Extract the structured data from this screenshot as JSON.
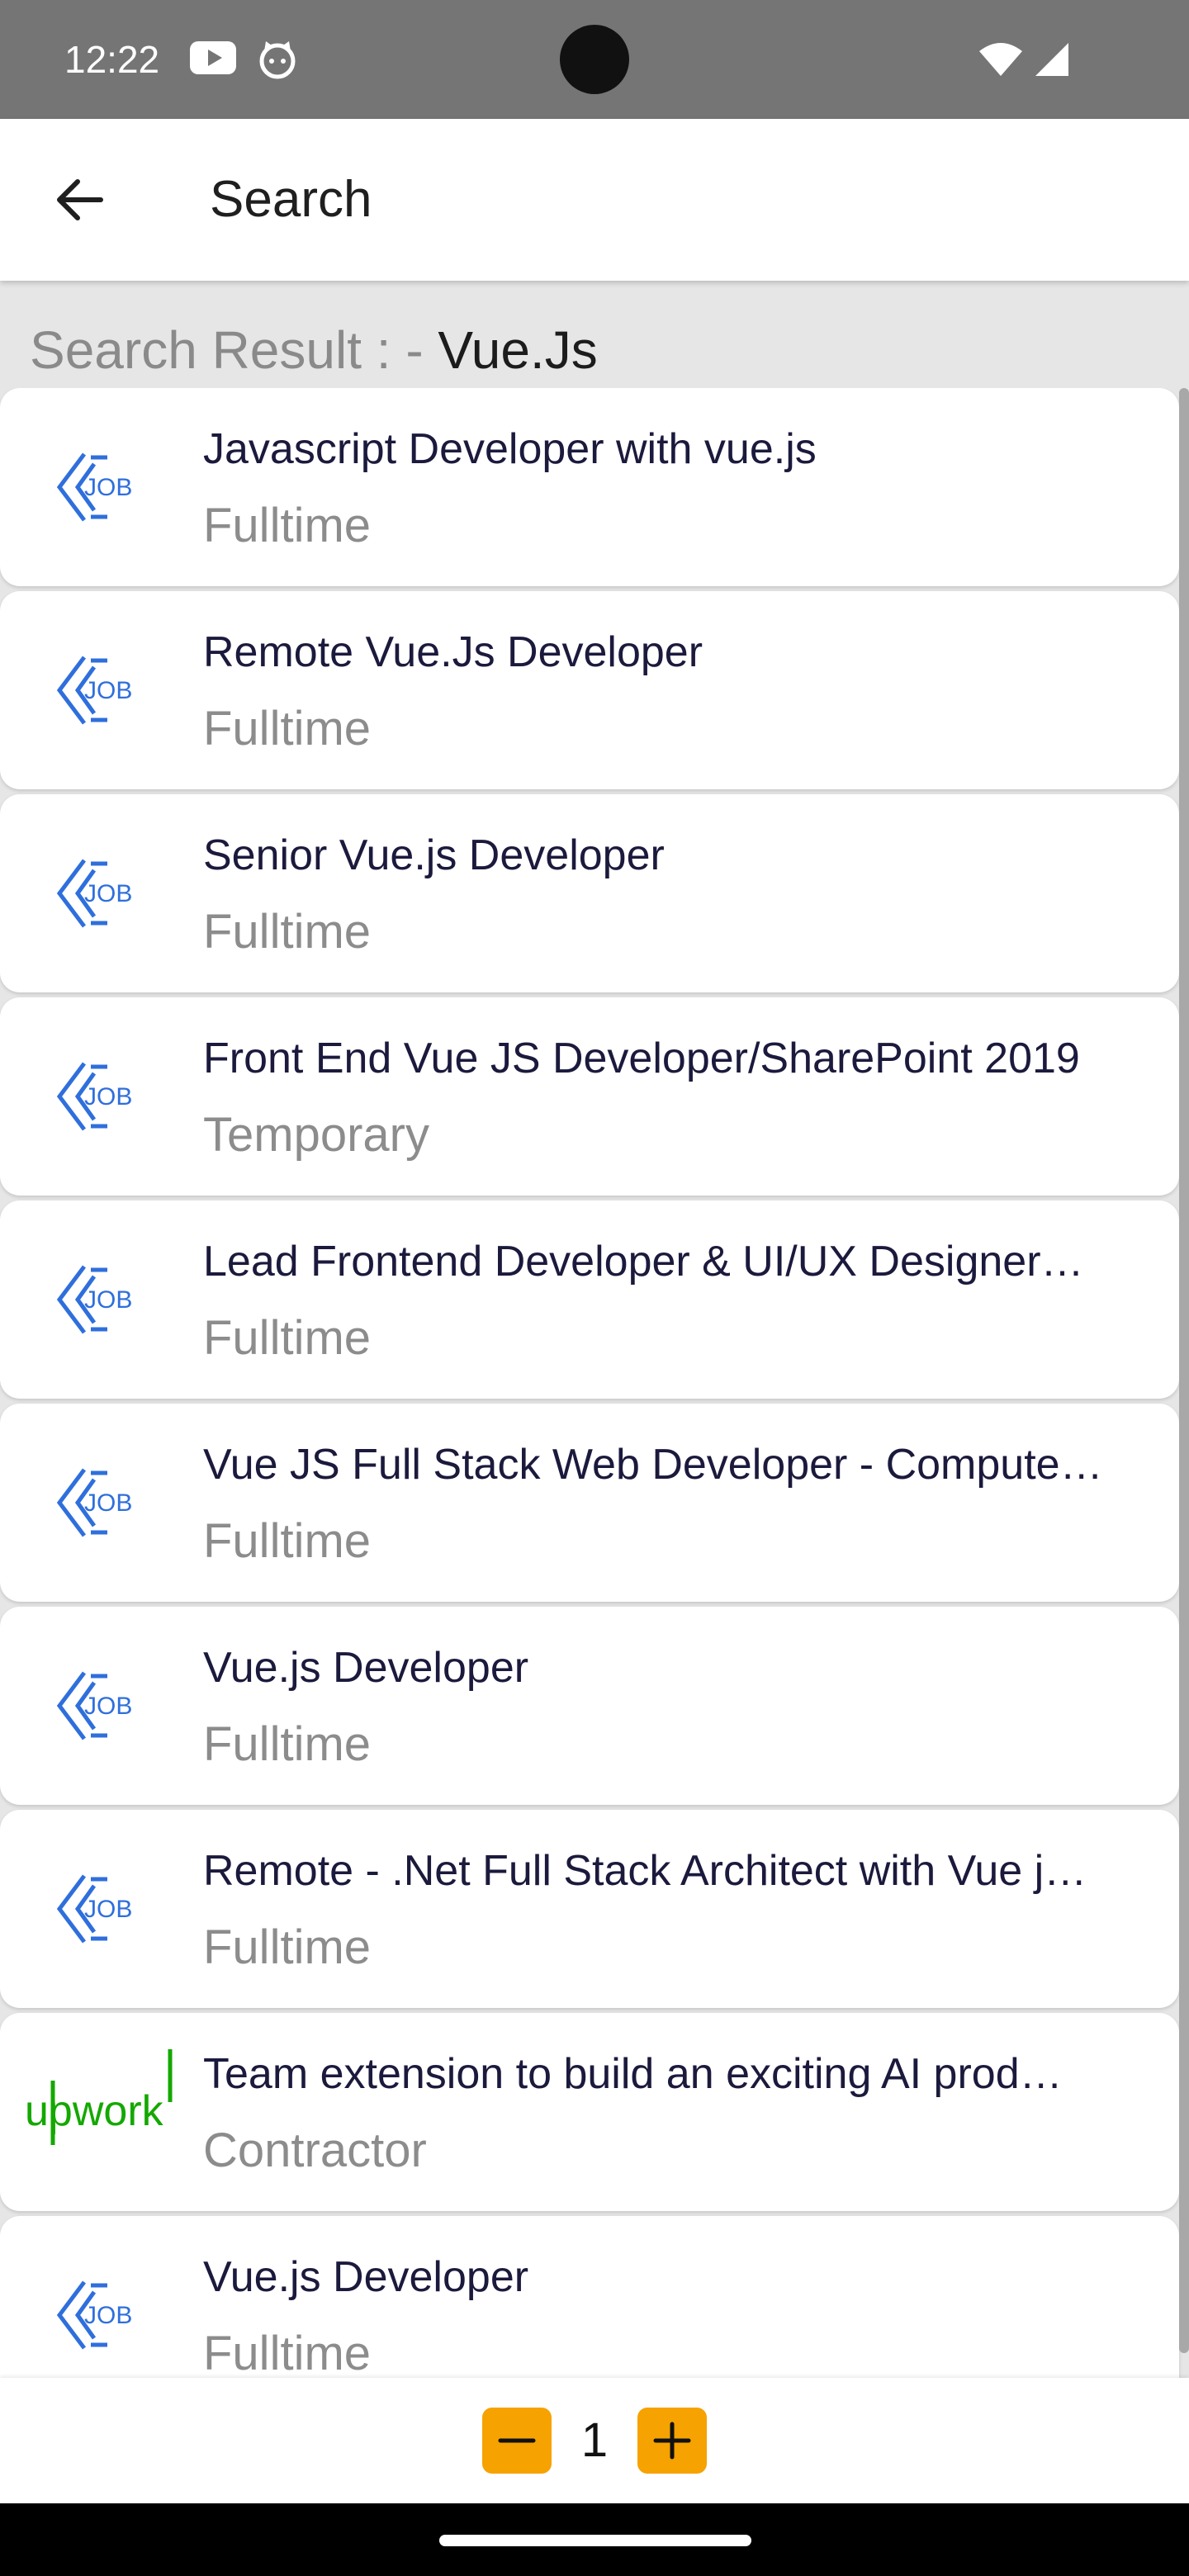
{
  "status_bar": {
    "time": "12:22",
    "icons": [
      "youtube-icon",
      "cat-face-icon",
      "wifi-icon",
      "signal-icon"
    ]
  },
  "app_bar": {
    "title": "Search",
    "back_icon": "arrow-back-icon"
  },
  "search": {
    "result_prefix": "Search Result : - ",
    "query": "Vue.Js"
  },
  "results": [
    {
      "title": "Javascript Developer with vue.js",
      "type": "Fulltime",
      "logo": "job-logo-icon"
    },
    {
      "title": "Remote Vue.Js Developer",
      "type": "Fulltime",
      "logo": "job-logo-icon"
    },
    {
      "title": "Senior Vue.js Developer",
      "type": "Fulltime",
      "logo": "job-logo-icon"
    },
    {
      "title": "Front End Vue JS Developer/SharePoint 2019",
      "type": "Temporary",
      "logo": "job-logo-icon"
    },
    {
      "title": "Lead Frontend Developer & UI/UX Designer…",
      "type": "Fulltime",
      "logo": "job-logo-icon"
    },
    {
      "title": "Vue JS Full Stack Web Developer - Compute…",
      "type": "Fulltime",
      "logo": "job-logo-icon"
    },
    {
      "title": "Vue.js Developer",
      "type": "Fulltime",
      "logo": "job-logo-icon"
    },
    {
      "title": "Remote - .Net Full Stack Architect with Vue j…",
      "type": "Fulltime",
      "logo": "job-logo-icon"
    },
    {
      "title": "Team extension to build an exciting AI prod…",
      "type": "Contractor",
      "logo": "upwork-logo"
    },
    {
      "title": "Vue.js Developer",
      "type": "Fulltime",
      "logo": "job-logo-icon"
    }
  ],
  "pager": {
    "page": "1",
    "minus_icon": "minus-icon",
    "plus_icon": "plus-icon"
  },
  "colors": {
    "accent": "#f6a200",
    "job_logo_blue": "#2f6fdc",
    "upwork_green": "#14a800",
    "status_bar": "#757575"
  }
}
